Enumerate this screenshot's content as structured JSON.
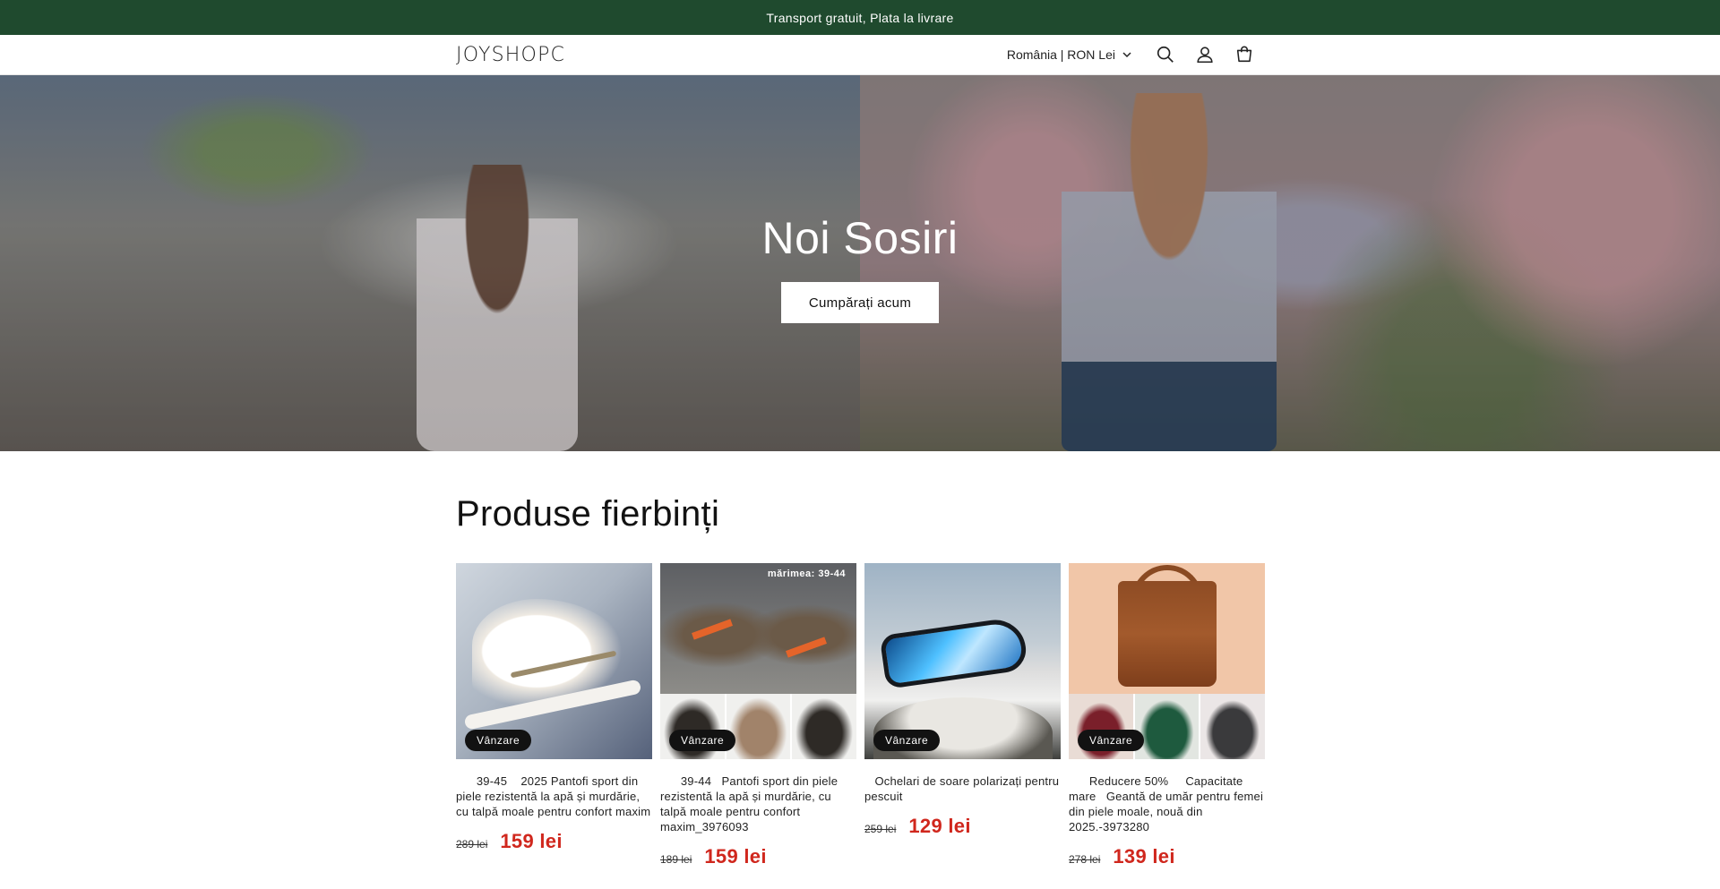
{
  "announcement": {
    "text": "Transport gratuit, Plata la livrare"
  },
  "header": {
    "logo": "JOYSHOPC",
    "locale": "România | RON Lei",
    "icons": [
      "search-icon",
      "account-icon",
      "cart-icon"
    ]
  },
  "hero": {
    "title": "Noi Sosiri",
    "button": "Cumpărați acum"
  },
  "products_section": {
    "title": "Produse fierbinți",
    "items": [
      {
        "badge": "Vânzare",
        "title": "      39-45    2025 Pantofi sport din piele rezistentă la apă și murdărie, cu talpă moale pentru confort maxim",
        "price_old": "289 lei",
        "price_new": "159 lei"
      },
      {
        "badge": "Vânzare",
        "image_label": "mărimea: 39-44",
        "title": "      39-44   Pantofi sport din piele rezistentă la apă și murdărie, cu talpă moale pentru confort maxim_3976093",
        "price_old": "189 lei",
        "price_new": "159 lei"
      },
      {
        "badge": "Vânzare",
        "title": "   Ochelari de soare polarizați pentru pescuit",
        "price_old": "259 lei",
        "price_new": "129 lei"
      },
      {
        "badge": "Vânzare",
        "title": "      Reducere 50%     Capacitate mare   Geantă de umăr pentru femei din piele moale, nouă din 2025.-3973280",
        "price_old": "278 lei",
        "price_new": "139 lei"
      }
    ]
  },
  "colors": {
    "announcement_bg": "#1f4a2e",
    "sale_price": "#d0271d",
    "badge_bg": "#121212"
  }
}
